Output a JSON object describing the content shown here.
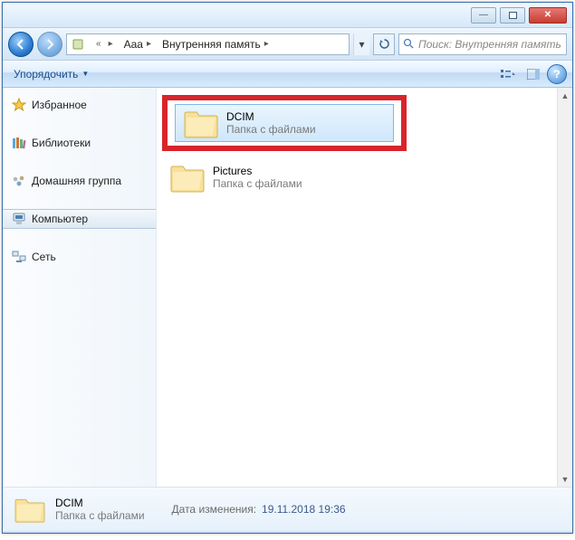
{
  "breadcrumb": {
    "root": "Aaa",
    "current": "Внутренняя память"
  },
  "search": {
    "placeholder": "Поиск: Внутренняя память"
  },
  "toolbar": {
    "organize": "Упорядочить"
  },
  "sidebar": {
    "favorites": "Избранное",
    "libraries": "Библиотеки",
    "homegroup": "Домашняя группа",
    "computer": "Компьютер",
    "network": "Сеть"
  },
  "items": [
    {
      "name": "DCIM",
      "sub": "Папка с файлами",
      "selected": true
    },
    {
      "name": "Pictures",
      "sub": "Папка с файлами",
      "selected": false
    }
  ],
  "details": {
    "name": "DCIM",
    "sub": "Папка с файлами",
    "date_label": "Дата изменения:",
    "date_value": "19.11.2018 19:36"
  }
}
